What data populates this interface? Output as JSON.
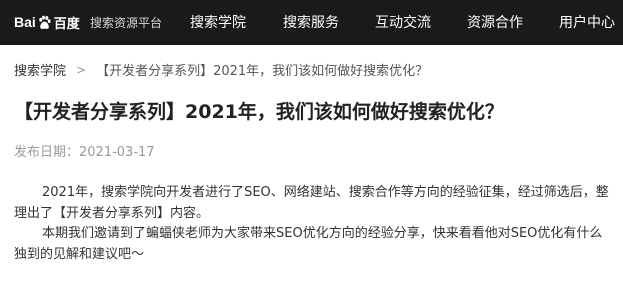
{
  "header": {
    "logo_text_left": "Bai",
    "logo_text_right": "百度",
    "platform_name": "搜索资源平台",
    "nav": [
      {
        "label": "搜索学院"
      },
      {
        "label": "搜索服务"
      },
      {
        "label": "互动交流"
      },
      {
        "label": "资源合作"
      },
      {
        "label": "用户中心"
      }
    ],
    "colors": {
      "bar_background": "#1a1a1a",
      "text": "#ffffff"
    }
  },
  "breadcrumb": {
    "parent": "搜索学院",
    "separator": ">",
    "current": "【开发者分享系列】2021年，我们该如何做好搜索优化？"
  },
  "article": {
    "title": "【开发者分享系列】2021年，我们该如何做好搜索优化？",
    "date_label": "发布日期：2021-03-17",
    "paragraphs": [
      "2021年，搜索学院向开发者进行了SEO、网络建站、搜索合作等方向的经验征集，经过筛选后，整理出了【开发者分享系列】内容。",
      "本期我们邀请到了蝙蝠侠老师为大家带来SEO优化方向的经验分享，快来看看他对SEO优化有什么独到的见解和建议吧～"
    ]
  }
}
